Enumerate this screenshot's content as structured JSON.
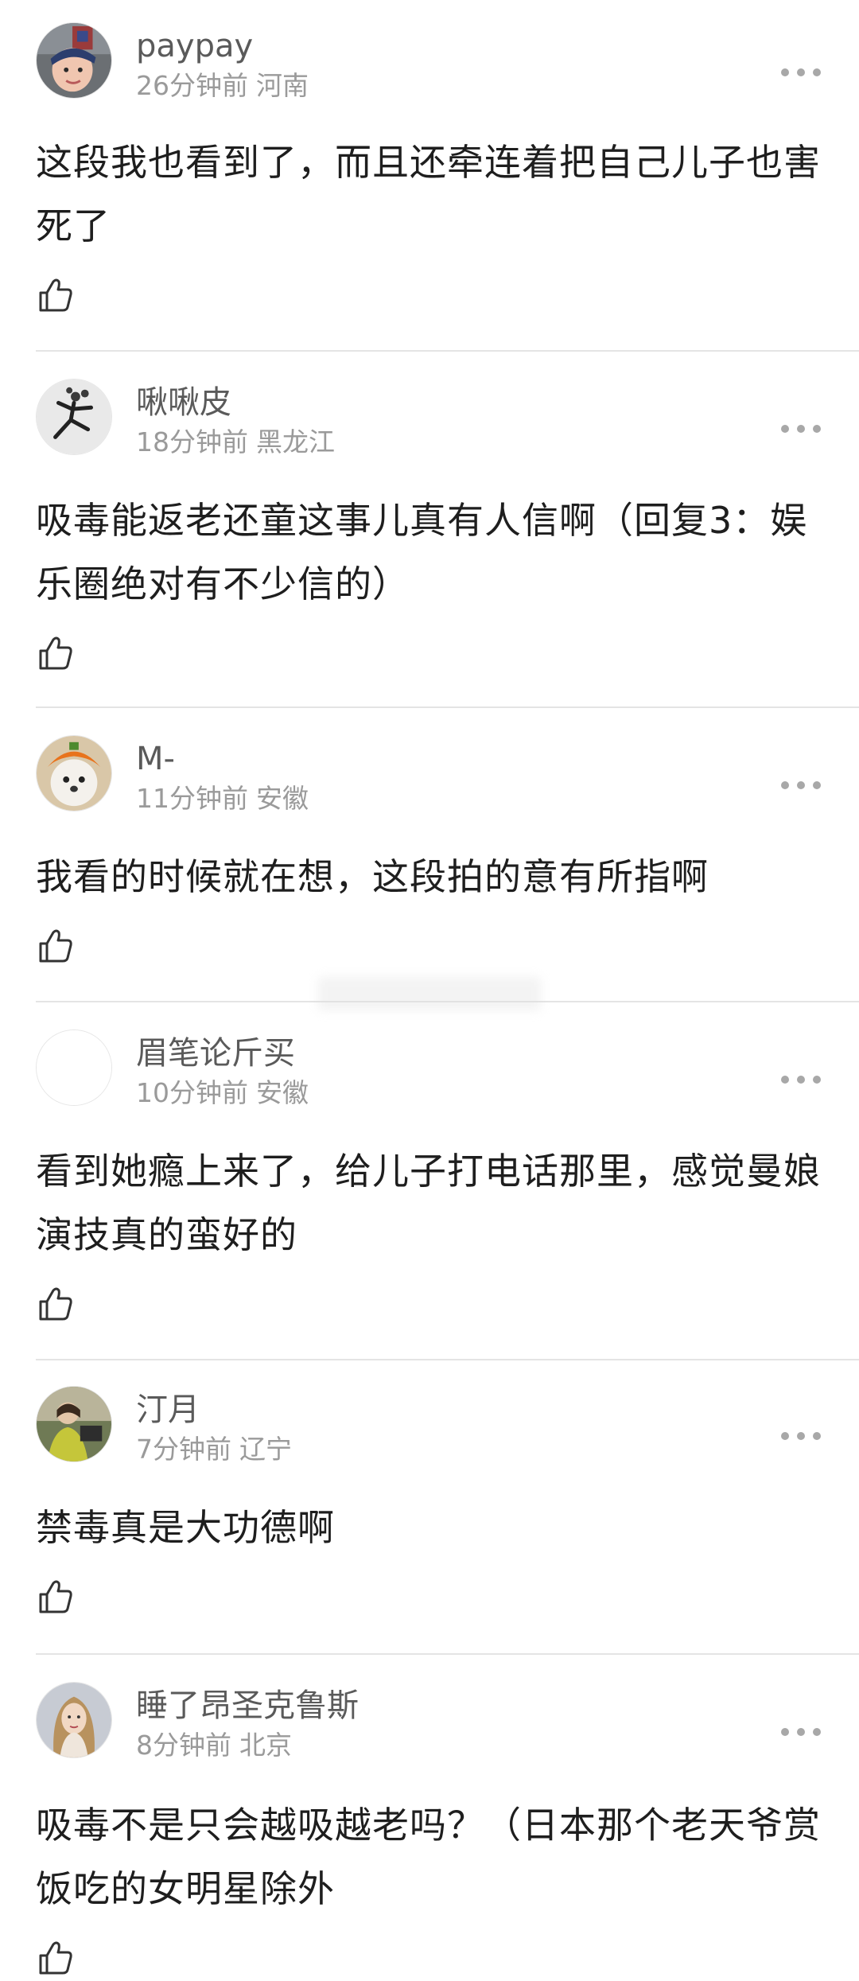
{
  "comments": [
    {
      "username": "paypay",
      "time": "26分钟前",
      "location": "河南",
      "text": "这段我也看到了，而且还牵连着把自己儿子也害死了",
      "avatar": "avatar-photo-child"
    },
    {
      "username": "啾啾皮",
      "time": "18分钟前",
      "location": "黑龙江",
      "text": "吸毒能返老还童这事儿真有人信啊（回复3：娱乐圈绝对有不少信的）",
      "avatar": "avatar-photo-dancer"
    },
    {
      "username": "M-",
      "time": "11分钟前",
      "location": "安徽",
      "text": "我看的时候就在想，这段拍的意有所指啊",
      "avatar": "avatar-photo-dog"
    },
    {
      "username": "眉笔论斤买",
      "time": "10分钟前",
      "location": "安徽",
      "text": "看到她瘾上来了，给儿子打电话那里，感觉曼娘演技真的蛮好的",
      "avatar": "avatar-blank"
    },
    {
      "username": "汀月",
      "time": "7分钟前",
      "location": "辽宁",
      "text": "禁毒真是大功德啊",
      "avatar": "avatar-photo-green"
    },
    {
      "username": "睡了昂圣克鲁斯",
      "time": "8分钟前",
      "location": "北京",
      "text": "吸毒不是只会越吸越老吗？（日本那个老天爷赏饭吃的女明星除外",
      "avatar": "avatar-photo-woman"
    }
  ],
  "icons": {
    "more": "more-dots-icon",
    "like": "thumbs-up-icon"
  }
}
